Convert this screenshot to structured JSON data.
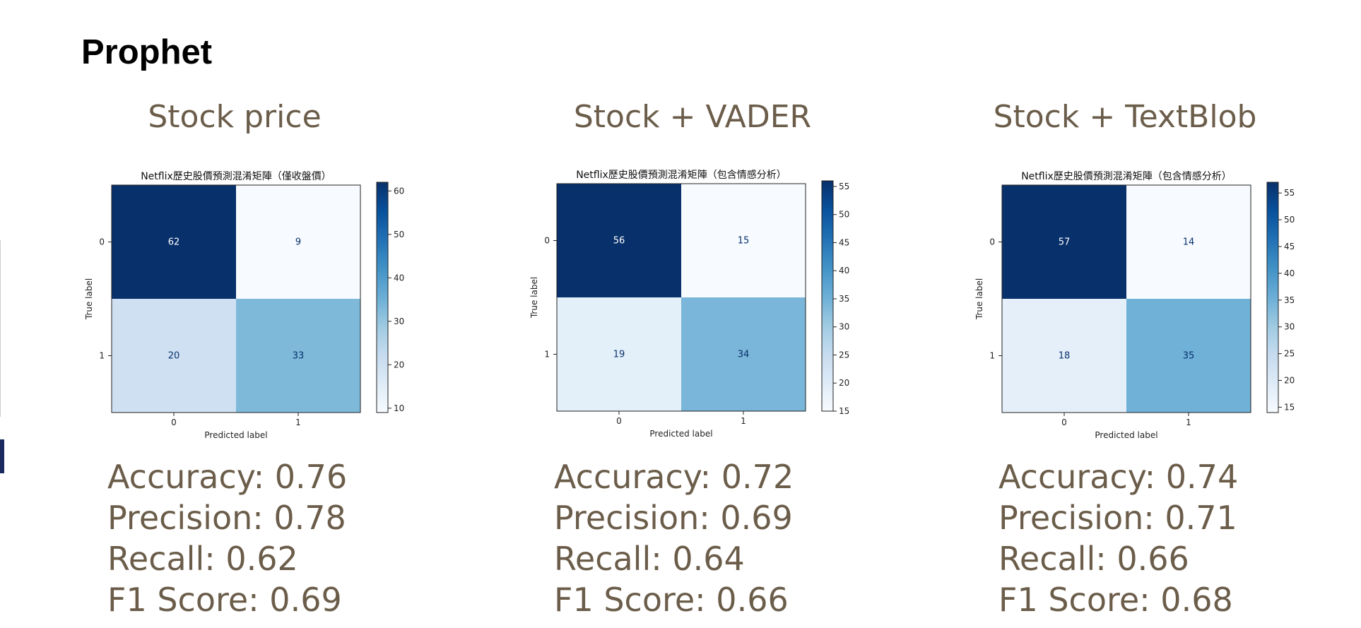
{
  "slide_title": "Prophet",
  "panels": [
    {
      "title": "Stock price",
      "metrics": {
        "accuracy": "Accuracy: 0.76",
        "precision": "Precision: 0.78",
        "recall": "Recall: 0.62",
        "f1": "F1 Score: 0.69"
      }
    },
    {
      "title": "Stock + VADER",
      "metrics": {
        "accuracy": "Accuracy: 0.72",
        "precision": "Precision: 0.69",
        "recall": "Recall: 0.64",
        "f1": "F1 Score: 0.66"
      }
    },
    {
      "title": "Stock + TextBlob",
      "metrics": {
        "accuracy": "Accuracy: 0.74",
        "precision": "Precision: 0.71",
        "recall": "Recall: 0.66",
        "f1": "F1 Score: 0.68"
      }
    }
  ],
  "chart_data": [
    {
      "type": "heatmap",
      "title": "Netflix歷史股價預測混淆矩陣（僅收盤價）",
      "xlabel": "Predicted label",
      "ylabel": "True label",
      "x_categories": [
        "0",
        "1"
      ],
      "y_categories": [
        "0",
        "1"
      ],
      "values": [
        [
          62,
          9
        ],
        [
          20,
          33
        ]
      ],
      "colorbar_ticks": [
        10,
        20,
        30,
        40,
        50,
        60
      ],
      "colorbar_range": [
        9,
        62
      ],
      "colormap": "Blues"
    },
    {
      "type": "heatmap",
      "title": "Netflix歷史股價預測混淆矩陣（包含情感分析）",
      "xlabel": "Predicted label",
      "ylabel": "True label",
      "x_categories": [
        "0",
        "1"
      ],
      "y_categories": [
        "0",
        "1"
      ],
      "values": [
        [
          56,
          15
        ],
        [
          19,
          34
        ]
      ],
      "colorbar_ticks": [
        15,
        20,
        25,
        30,
        35,
        40,
        45,
        50,
        55
      ],
      "colorbar_range": [
        15,
        56
      ],
      "colormap": "Blues"
    },
    {
      "type": "heatmap",
      "title": "Netflix歷史股價預測混淆矩陣（包含情感分析）",
      "xlabel": "Predicted label",
      "ylabel": "True label",
      "x_categories": [
        "0",
        "1"
      ],
      "y_categories": [
        "0",
        "1"
      ],
      "values": [
        [
          57,
          14
        ],
        [
          18,
          35
        ]
      ],
      "colorbar_ticks": [
        15,
        20,
        25,
        30,
        35,
        40,
        45,
        50,
        55
      ],
      "colorbar_range": [
        14,
        57
      ],
      "colormap": "Blues"
    }
  ]
}
